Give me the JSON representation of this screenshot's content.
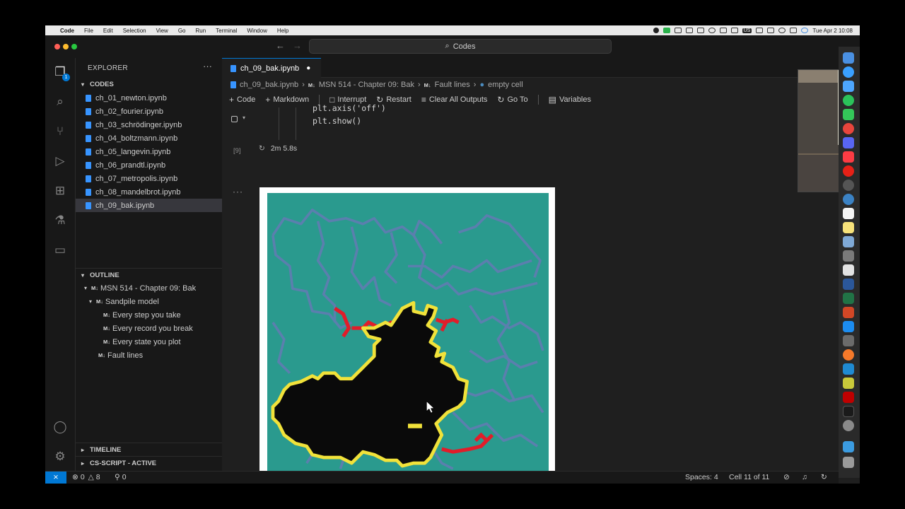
{
  "menubar": {
    "apple": "",
    "items": [
      "Code",
      "File",
      "Edit",
      "Selection",
      "View",
      "Go",
      "Run",
      "Terminal",
      "Window",
      "Help"
    ],
    "status_tag": "US",
    "datetime": "Tue Apr 2  10:08"
  },
  "window": {
    "search_label": "Codes",
    "search_icon": "search-icon"
  },
  "activity_bar": {
    "explorer_badge": "1",
    "icons": [
      "files-icon",
      "search-icon",
      "source-control-icon",
      "run-debug-icon",
      "extensions-icon",
      "testing-icon",
      "remote-explorer-icon"
    ],
    "bottom_icons": [
      "account-icon",
      "settings-gear-icon"
    ]
  },
  "sidebar": {
    "title": "EXPLORER",
    "more": "···",
    "folder": "CODES",
    "files": [
      "ch_01_newton.ipynb",
      "ch_02_fourier.ipynb",
      "ch_03_schrödinger.ipynb",
      "ch_04_boltzmann.ipynb",
      "ch_05_langevin.ipynb",
      "ch_06_prandtl.ipynb",
      "ch_07_metropolis.ipynb",
      "ch_08_mandelbrot.ipynb",
      "ch_09_bak.ipynb"
    ],
    "outline_title": "OUTLINE",
    "md_tag": "M↓",
    "outline": [
      "MSN 514 - Chapter 09: Bak",
      "Sandpile model",
      "Every step you take",
      "Every record you break",
      "Every state you plot",
      "Fault lines"
    ],
    "timeline": "TIMELINE",
    "cs_script": "CS-SCRIPT - ACTIVE"
  },
  "editor": {
    "tab_label": "ch_09_bak.ipynb",
    "tab_dirty": "●",
    "breadcrumb": {
      "file": "ch_09_bak.ipynb",
      "md1": "M↓",
      "section": "MSN 514 - Chapter 09: Bak",
      "md2": "M↓",
      "subsection": "Fault lines",
      "cell": "empty cell"
    },
    "toolbar": {
      "code": "Code",
      "markdown": "Markdown",
      "interrupt": "Interrupt",
      "restart": "Restart",
      "clear": "Clear All Outputs",
      "goto": "Go To",
      "variables": "Variables"
    },
    "code_lines": [
      "plt.axis('off')",
      "plt.show()"
    ],
    "exec_count": "[9]",
    "exec_time": "2m 5.8s",
    "output_more": "···"
  },
  "plot": {
    "background_color": "#2a9a8e",
    "fault_color": "#5a7fb0",
    "cluster_color": "#0a0a0a",
    "boundary_color": "#f1e23a",
    "active_color": "#e11d2a"
  },
  "camera_buttons": [
    "copy-icon",
    "chart-icon",
    "save-icon"
  ],
  "statusbar": {
    "errors": "0",
    "warnings": "8",
    "ports": "0",
    "spaces": "Spaces: 4",
    "cell": "Cell 11 of 11"
  }
}
